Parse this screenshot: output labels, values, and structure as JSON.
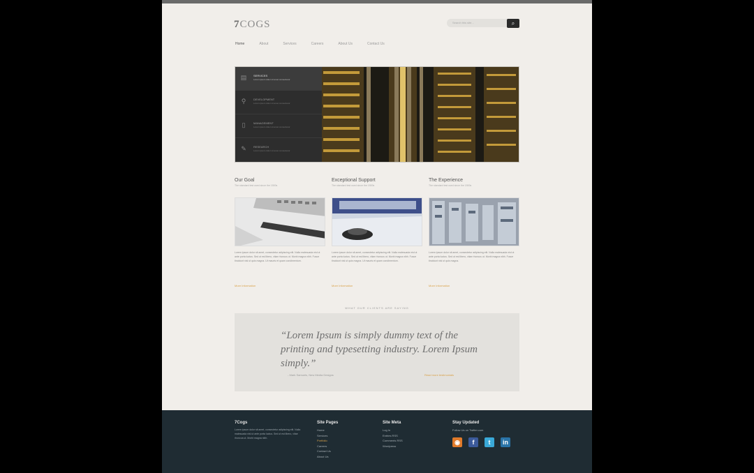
{
  "brand": {
    "number": "7",
    "name": "COGS"
  },
  "search": {
    "placeholder": "Search this site..."
  },
  "nav": [
    "Home",
    "About",
    "Services",
    "Careers",
    "About Us",
    "Contact Us"
  ],
  "slider": {
    "items": [
      {
        "title": "SERVICES",
        "subtitle": "Lorem ipsum dolor sit amet consectetur",
        "icon": "document-icon"
      },
      {
        "title": "DEVELOPMENT",
        "subtitle": "Lorem ipsum dolor sit amet consectetur",
        "icon": "magnifier-icon"
      },
      {
        "title": "MANAGEMENT",
        "subtitle": "Lorem ipsum dolor sit amet consectetur",
        "icon": "phone-icon"
      },
      {
        "title": "RESEARCH",
        "subtitle": "Lorem ipsum dolor sit amet consectetur",
        "icon": "pen-icon"
      }
    ]
  },
  "columns": [
    {
      "heading": "Our Goal",
      "subheading": "The standard test used since the 1500s",
      "body": "Lorem ipsum dolor sit amet, consectetur adipiscing elit. Nulla malesuada nisl ut ante porta luctus. Sed ut est libero, vitae rhoncus ut. Morbi magna nibh. Fusce tincidunt nisl ut quis magna. Ut mauris et quam condimentum.",
      "more": "More Information"
    },
    {
      "heading": "Exceptional Support",
      "subheading": "The standard test used since the 1500s",
      "body": "Lorem ipsum dolor sit amet, consectetur adipiscing elit. Nulla malesuada nisl ut ante porta luctus. Sed ut est libero, vitae rhoncus ut. Morbi magna nibh. Fusce tincidunt nisl ut quis magna. Ut mauris et quam condimentum.",
      "more": "More Information"
    },
    {
      "heading": "The Experience",
      "subheading": "The standard test used since the 1500s",
      "body": "Lorem ipsum dolor sit amet, consectetur adipiscing elit. Nulla malesuada nisl ut ante porta luctus. Sed ut est libero, vitae rhoncus ut. Morbi magna nibh. Fusce tincidunt nisl ut quis magna.",
      "more": "More Information"
    }
  ],
  "clients_heading": "WHAT OUR CLIENTS ARE SAYING",
  "testimonial": {
    "quote": "“Lorem Ipsum is simply dummy text of the printing and typesetting industry. Lorem Ipsum simply.”",
    "author": "- Mark Samuels, New Media Designs",
    "link": "Read more testimonials"
  },
  "footer": {
    "about": {
      "heading": "7Cogs",
      "text": "Lorem ipsum dolor sit amet, consectetur adipiscing elit. Nulla malesuada nisl ut ante porta luctus. Sed ut est libero, vitae rhoncus ut. Morbi magna nibh."
    },
    "site_pages": {
      "heading": "Site Pages",
      "links": [
        "Home",
        "Services",
        "Portfolio",
        "Careers",
        "Contact Us",
        "About Us"
      ]
    },
    "site_meta": {
      "heading": "Site Meta",
      "links": [
        "Log In",
        "Entries RSS",
        "Comments RSS",
        "Wordpress"
      ]
    },
    "updated": {
      "heading": "Stay Updated",
      "text": "Follow Us on Twitter.com",
      "social": [
        "rss-icon",
        "facebook-icon",
        "twitter-icon",
        "linkedin-icon"
      ]
    }
  },
  "colors": {
    "accent": "#d9a24a",
    "footer_bg": "#1f2c33",
    "page_bg": "#f1eeea"
  }
}
